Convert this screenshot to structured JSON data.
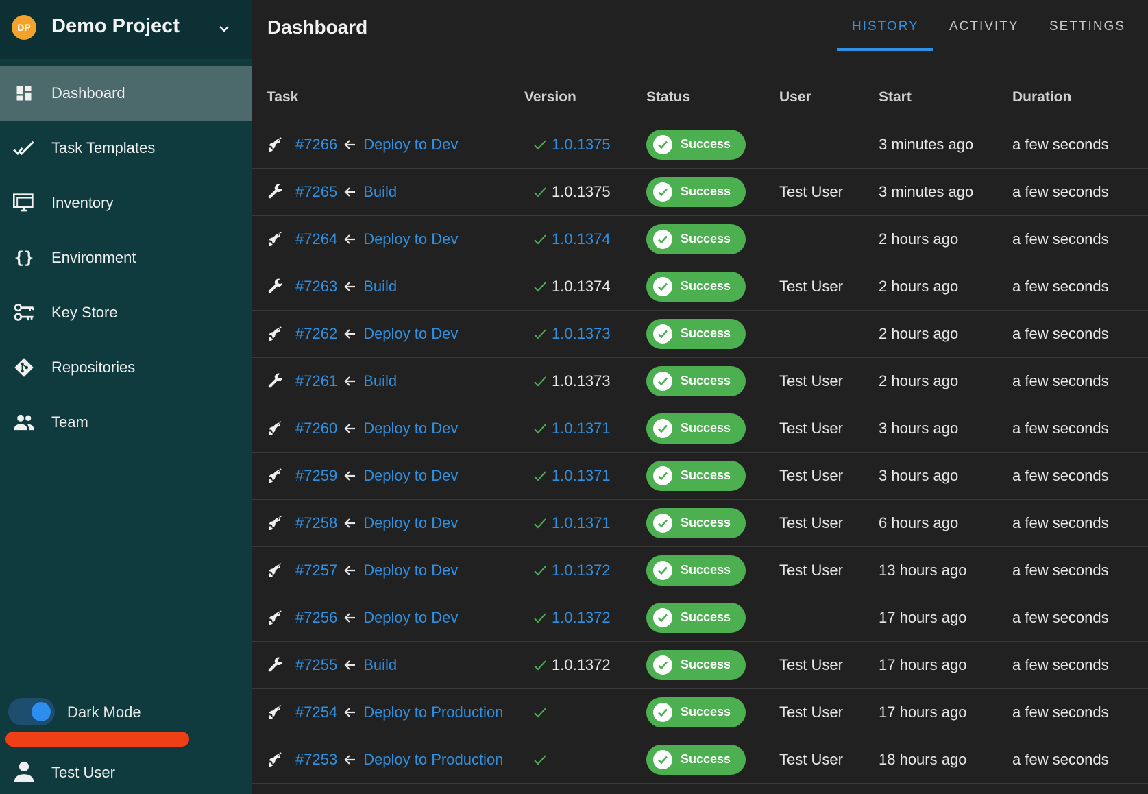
{
  "project": {
    "initials": "DP",
    "name": "Demo Project"
  },
  "nav": [
    {
      "label": "Dashboard",
      "icon": "dashboard-icon"
    },
    {
      "label": "Task Templates",
      "icon": "double-check-icon"
    },
    {
      "label": "Inventory",
      "icon": "monitor-icon"
    },
    {
      "label": "Environment",
      "icon": "braces-icon"
    },
    {
      "label": "Key Store",
      "icon": "keys-icon"
    },
    {
      "label": "Repositories",
      "icon": "git-icon"
    },
    {
      "label": "Team",
      "icon": "team-icon"
    }
  ],
  "dark_mode": {
    "label": "Dark Mode"
  },
  "user": {
    "name": "Test User"
  },
  "header": {
    "title": "Dashboard"
  },
  "tabs": [
    "HISTORY",
    "ACTIVITY",
    "SETTINGS"
  ],
  "table": {
    "columns": [
      "Task",
      "Version",
      "Status",
      "User",
      "Start",
      "Duration"
    ],
    "rows": [
      {
        "type": "rocket",
        "id": "#7266",
        "template": "Deploy to Dev",
        "version": "1.0.1375",
        "version_link": true,
        "status": "Success",
        "user": "",
        "start": "3 minutes ago",
        "duration": "a few seconds"
      },
      {
        "type": "wrench",
        "id": "#7265",
        "template": "Build",
        "version": "1.0.1375",
        "version_link": false,
        "status": "Success",
        "user": "Test User",
        "start": "3 minutes ago",
        "duration": "a few seconds"
      },
      {
        "type": "rocket",
        "id": "#7264",
        "template": "Deploy to Dev",
        "version": "1.0.1374",
        "version_link": true,
        "status": "Success",
        "user": "",
        "start": "2 hours ago",
        "duration": "a few seconds"
      },
      {
        "type": "wrench",
        "id": "#7263",
        "template": "Build",
        "version": "1.0.1374",
        "version_link": false,
        "status": "Success",
        "user": "Test User",
        "start": "2 hours ago",
        "duration": "a few seconds"
      },
      {
        "type": "rocket",
        "id": "#7262",
        "template": "Deploy to Dev",
        "version": "1.0.1373",
        "version_link": true,
        "status": "Success",
        "user": "",
        "start": "2 hours ago",
        "duration": "a few seconds"
      },
      {
        "type": "wrench",
        "id": "#7261",
        "template": "Build",
        "version": "1.0.1373",
        "version_link": false,
        "status": "Success",
        "user": "Test User",
        "start": "2 hours ago",
        "duration": "a few seconds"
      },
      {
        "type": "rocket",
        "id": "#7260",
        "template": "Deploy to Dev",
        "version": "1.0.1371",
        "version_link": true,
        "status": "Success",
        "user": "Test User",
        "start": "3 hours ago",
        "duration": "a few seconds"
      },
      {
        "type": "rocket",
        "id": "#7259",
        "template": "Deploy to Dev",
        "version": "1.0.1371",
        "version_link": true,
        "status": "Success",
        "user": "Test User",
        "start": "3 hours ago",
        "duration": "a few seconds"
      },
      {
        "type": "rocket",
        "id": "#7258",
        "template": "Deploy to Dev",
        "version": "1.0.1371",
        "version_link": true,
        "status": "Success",
        "user": "Test User",
        "start": "6 hours ago",
        "duration": "a few seconds"
      },
      {
        "type": "rocket",
        "id": "#7257",
        "template": "Deploy to Dev",
        "version": "1.0.1372",
        "version_link": true,
        "status": "Success",
        "user": "Test User",
        "start": "13 hours ago",
        "duration": "a few seconds"
      },
      {
        "type": "rocket",
        "id": "#7256",
        "template": "Deploy to Dev",
        "version": "1.0.1372",
        "version_link": true,
        "status": "Success",
        "user": "",
        "start": "17 hours ago",
        "duration": "a few seconds"
      },
      {
        "type": "wrench",
        "id": "#7255",
        "template": "Build",
        "version": "1.0.1372",
        "version_link": false,
        "status": "Success",
        "user": "Test User",
        "start": "17 hours ago",
        "duration": "a few seconds"
      },
      {
        "type": "rocket",
        "id": "#7254",
        "template": "Deploy to Production",
        "version": "",
        "version_link": false,
        "status": "Success",
        "user": "Test User",
        "start": "17 hours ago",
        "duration": "a few seconds"
      },
      {
        "type": "rocket",
        "id": "#7253",
        "template": "Deploy to Production",
        "version": "",
        "version_link": false,
        "status": "Success",
        "user": "Test User",
        "start": "18 hours ago",
        "duration": "a few seconds"
      }
    ]
  },
  "colors": {
    "sidebar": "#0f3b3f",
    "accent": "#2f8fe0",
    "success": "#4caf50",
    "annotation": "#ee3f16"
  }
}
